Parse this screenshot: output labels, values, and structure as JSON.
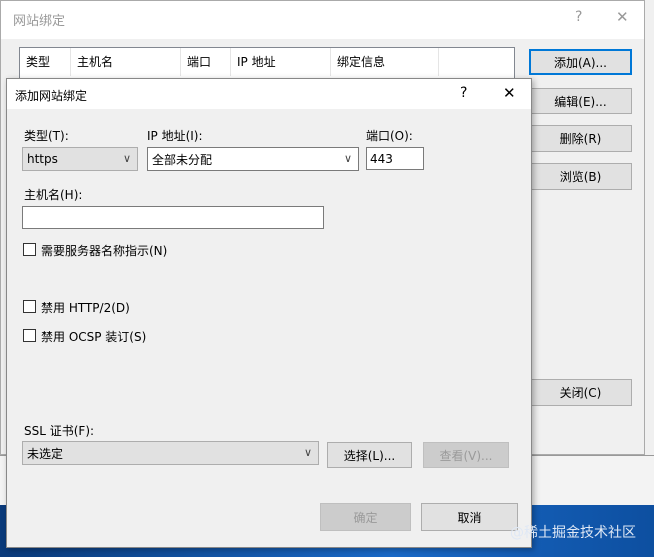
{
  "outer": {
    "title": "网站绑定",
    "help": "?",
    "close": "✕",
    "columns": [
      "类型",
      "主机名",
      "端口",
      "IP 地址",
      "绑定信息"
    ],
    "buttons": {
      "add": "添加(A)...",
      "edit": "编辑(E)...",
      "remove": "删除(R)",
      "browse": "浏览(B)",
      "close": "关闭(C)"
    }
  },
  "dialog": {
    "title": "添加网站绑定",
    "help": "?",
    "close": "✕",
    "type_label": "类型(T):",
    "type_value": "https",
    "ip_label": "IP 地址(I):",
    "ip_value": "全部未分配",
    "port_label": "端口(O):",
    "port_value": "443",
    "host_label": "主机名(H):",
    "host_value": "",
    "sni_label": "需要服务器名称指示(N)",
    "http2_label": "禁用 HTTP/2(D)",
    "ocsp_label": "禁用 OCSP 装订(S)",
    "ssl_label": "SSL 证书(F):",
    "ssl_value": "未选定",
    "select_button": "选择(L)...",
    "view_button": "查看(V)...",
    "ok_button": "确定",
    "cancel_button": "取消"
  },
  "watermark": "@稀土掘金技术社区"
}
